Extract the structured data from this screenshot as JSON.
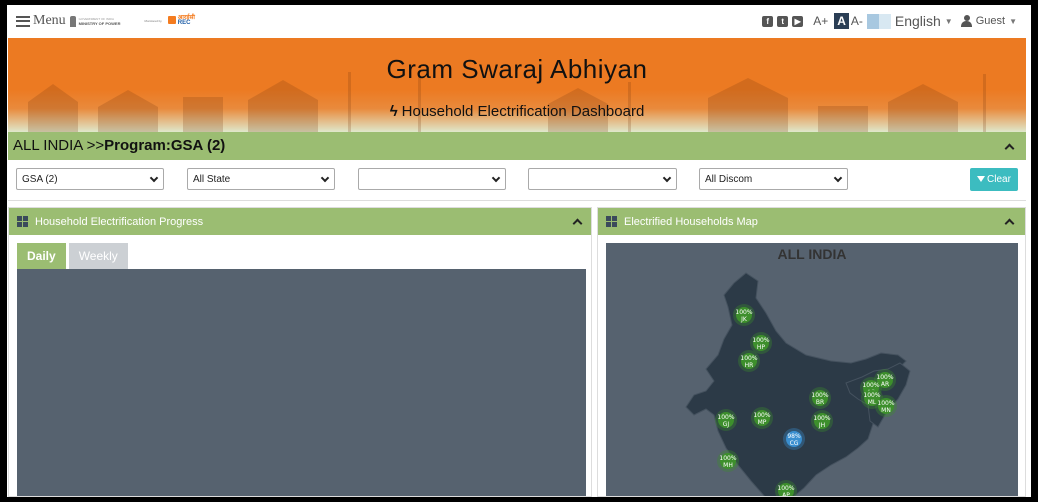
{
  "topbar": {
    "menu_label": "Menu",
    "ministry_line1": "GOVERNMENT OF INDIA",
    "ministry_line2": "MINISTRY OF POWER",
    "mobile_text": "Monitored by",
    "rec_line1": "आरईसी",
    "rec_line2": "REC",
    "social": [
      "facebook-icon",
      "twitter-icon",
      "youtube-icon"
    ],
    "font_increase": "A+",
    "font_normal": "A",
    "font_decrease": "A-",
    "language": "English",
    "user": "Guest"
  },
  "banner": {
    "title": "Gram Swaraj Abhiyan",
    "subtitle": "Household Electrification Dashboard"
  },
  "breadcrumb": {
    "prefix": "ALL INDIA >>",
    "current": "Program:GSA (2)"
  },
  "filters": {
    "program": "GSA (2)",
    "state": "All State",
    "district": "",
    "block": "",
    "discom": "All Discom",
    "clear_label": "Clear"
  },
  "progress_panel": {
    "title": "Household Electrification Progress",
    "tabs": [
      "Daily",
      "Weekly"
    ],
    "active_tab": "Daily"
  },
  "map_panel": {
    "title": "Electrified Households Map",
    "map_title": "ALL INDIA",
    "markers": [
      {
        "code": "JK",
        "pct": "100%"
      },
      {
        "code": "HP",
        "pct": "100%"
      },
      {
        "code": "HR",
        "pct": "100%"
      },
      {
        "code": "AR",
        "pct": "100%"
      },
      {
        "code": "AS",
        "pct": "100%"
      },
      {
        "code": "ML",
        "pct": "100%"
      },
      {
        "code": "MN",
        "pct": "100%"
      },
      {
        "code": "BR",
        "pct": "100%"
      },
      {
        "code": "GJ",
        "pct": "100%"
      },
      {
        "code": "MP",
        "pct": "100%"
      },
      {
        "code": "JH",
        "pct": "100%"
      },
      {
        "code": "CG",
        "pct": "98%"
      },
      {
        "code": "MH",
        "pct": "100%"
      },
      {
        "code": "AP",
        "pct": "100%"
      }
    ]
  },
  "colors": {
    "brand_orange": "#ec7a22",
    "panel_green": "#9bbd72",
    "clear_teal": "#3cbcc0",
    "map_bg": "#56626f",
    "marker_green": "#3d8f2c",
    "marker_blue": "#3a8fd0"
  }
}
